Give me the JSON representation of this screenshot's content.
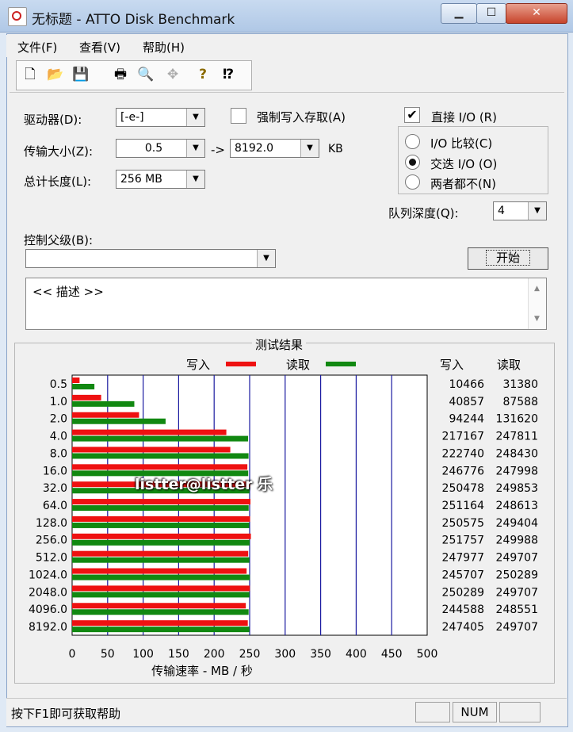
{
  "window": {
    "title": "无标题 - ATTO Disk Benchmark"
  },
  "titlebar_buttons": {
    "min": "▁",
    "max": "☐",
    "close": "✕"
  },
  "menu": [
    "文件(F)",
    "查看(V)",
    "帮助(H)"
  ],
  "toolbar_icons": [
    "new-icon",
    "open-icon",
    "save-icon",
    "print-icon",
    "print-preview-icon",
    "move-icon",
    "help-icon",
    "context-help-icon"
  ],
  "toolbar_glyphs": [
    "🗋",
    "📂",
    "💾",
    "🖶",
    "🔍",
    "✥",
    "?",
    "⁉"
  ],
  "settings": {
    "drive_label": "驱动器(D):",
    "drive_value": "[-e-]",
    "transfer_label": "传输大小(Z):",
    "transfer_from": "0.5",
    "transfer_to_label": "->",
    "transfer_to": "8192.0",
    "transfer_unit": "KB",
    "length_label": "总计长度(L):",
    "length_value": "256 MB",
    "force_write_label": "强制写入存取(A)",
    "direct_io_label": "直接 I/O (R)",
    "direct_io_checked": "✔",
    "radio_compare": "I/O 比较(C)",
    "radio_overlapped": "交迭 I/O (O)",
    "radio_neither": "两者都不(N)",
    "queue_label": "队列深度(Q):",
    "queue_value": "4",
    "control_label": "控制父级(B):",
    "control_value": "",
    "start_button": "开始",
    "description": "<< 描述 >>"
  },
  "results": {
    "title": "测试结果",
    "legend_write": "写入",
    "legend_read": "读取",
    "col_write": "写入",
    "col_read": "读取",
    "watermark": "listter@listter 乐"
  },
  "chart_data": {
    "type": "bar",
    "orientation": "horizontal",
    "categories": [
      "0.5",
      "1.0",
      "2.0",
      "4.0",
      "8.0",
      "16.0",
      "32.0",
      "64.0",
      "128.0",
      "256.0",
      "512.0",
      "1024.0",
      "2048.0",
      "4096.0",
      "8192.0"
    ],
    "series": [
      {
        "name": "写入",
        "color": "#ee1111",
        "values": [
          10466,
          40857,
          94244,
          217167,
          222740,
          246776,
          250478,
          251164,
          250575,
          251757,
          247977,
          245707,
          250289,
          244588,
          247405
        ]
      },
      {
        "name": "读取",
        "color": "#118811",
        "values": [
          31380,
          87588,
          131620,
          247811,
          248430,
          247998,
          249853,
          248613,
          249404,
          249988,
          249707,
          250289,
          249707,
          248551,
          249707
        ]
      }
    ],
    "xlabel": "传输速率 - MB / 秒",
    "xticks": [
      "0",
      "50",
      "100",
      "150",
      "200",
      "250",
      "300",
      "350",
      "400",
      "450",
      "500"
    ],
    "xlim": [
      0,
      500
    ],
    "grid": true,
    "legend": "top"
  },
  "status": {
    "text": "按下F1即可获取帮助",
    "num": "NUM"
  }
}
